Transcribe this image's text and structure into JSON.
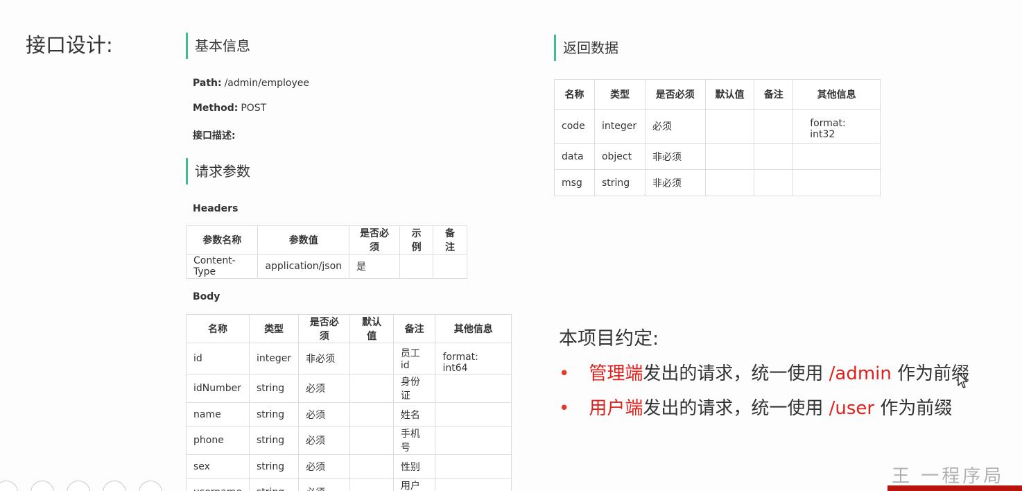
{
  "page": {
    "heading": "接口设计:"
  },
  "basic_info": {
    "title": "基本信息",
    "path_label": "Path:",
    "path_value": "/admin/employee",
    "method_label": "Method:",
    "method_value": "POST",
    "desc_label": "接口描述:"
  },
  "request_params": {
    "title": "请求参数",
    "headers_label": "Headers",
    "headers_table": {
      "columns": [
        "参数名称",
        "参数值",
        "是否必须",
        "示例",
        "备注"
      ],
      "rows": [
        [
          "Content-Type",
          "application/json",
          "是",
          "",
          ""
        ]
      ]
    },
    "body_label": "Body",
    "body_table": {
      "columns": [
        "名称",
        "类型",
        "是否必须",
        "默认值",
        "备注",
        "其他信息"
      ],
      "rows": [
        [
          "id",
          "integer",
          "非必须",
          "",
          "员工id",
          "format: int64"
        ],
        [
          "idNumber",
          "string",
          "必须",
          "",
          "身份证",
          ""
        ],
        [
          "name",
          "string",
          "必须",
          "",
          "姓名",
          ""
        ],
        [
          "phone",
          "string",
          "必须",
          "",
          "手机号",
          ""
        ],
        [
          "sex",
          "string",
          "必须",
          "",
          "性别",
          ""
        ],
        [
          "username",
          "string",
          "必须",
          "",
          "用户名",
          ""
        ]
      ]
    }
  },
  "return_data": {
    "title": "返回数据",
    "table": {
      "columns": [
        "名称",
        "类型",
        "是否必须",
        "默认值",
        "备注",
        "其他信息"
      ],
      "rows": [
        [
          "code",
          "integer",
          "必须",
          "",
          "",
          "format: int32"
        ],
        [
          "data",
          "object",
          "非必须",
          "",
          "",
          ""
        ],
        [
          "msg",
          "string",
          "非必须",
          "",
          "",
          ""
        ]
      ]
    }
  },
  "convention": {
    "title": "本项目约定:",
    "bullets": [
      {
        "dot": "•",
        "highlight": "管理端",
        "middle": "发出的请求，统一使用 ",
        "prefix": "/admin",
        "tail": " 作为前缀"
      },
      {
        "dot": "•",
        "highlight": "用户端",
        "middle": "发出的请求，统一使用 ",
        "prefix": "/user",
        "tail": " 作为前缀"
      }
    ]
  },
  "watermark": "王 一程序局",
  "colors": {
    "accent_bar": "#3dbd8d",
    "highlight_red": "#e0201b",
    "bullet_red": "#e03a2e"
  },
  "icons": [
    "pen-icon",
    "grid-icon",
    "circle-icon",
    "circle-icon",
    "mouse-pointer-icon"
  ]
}
